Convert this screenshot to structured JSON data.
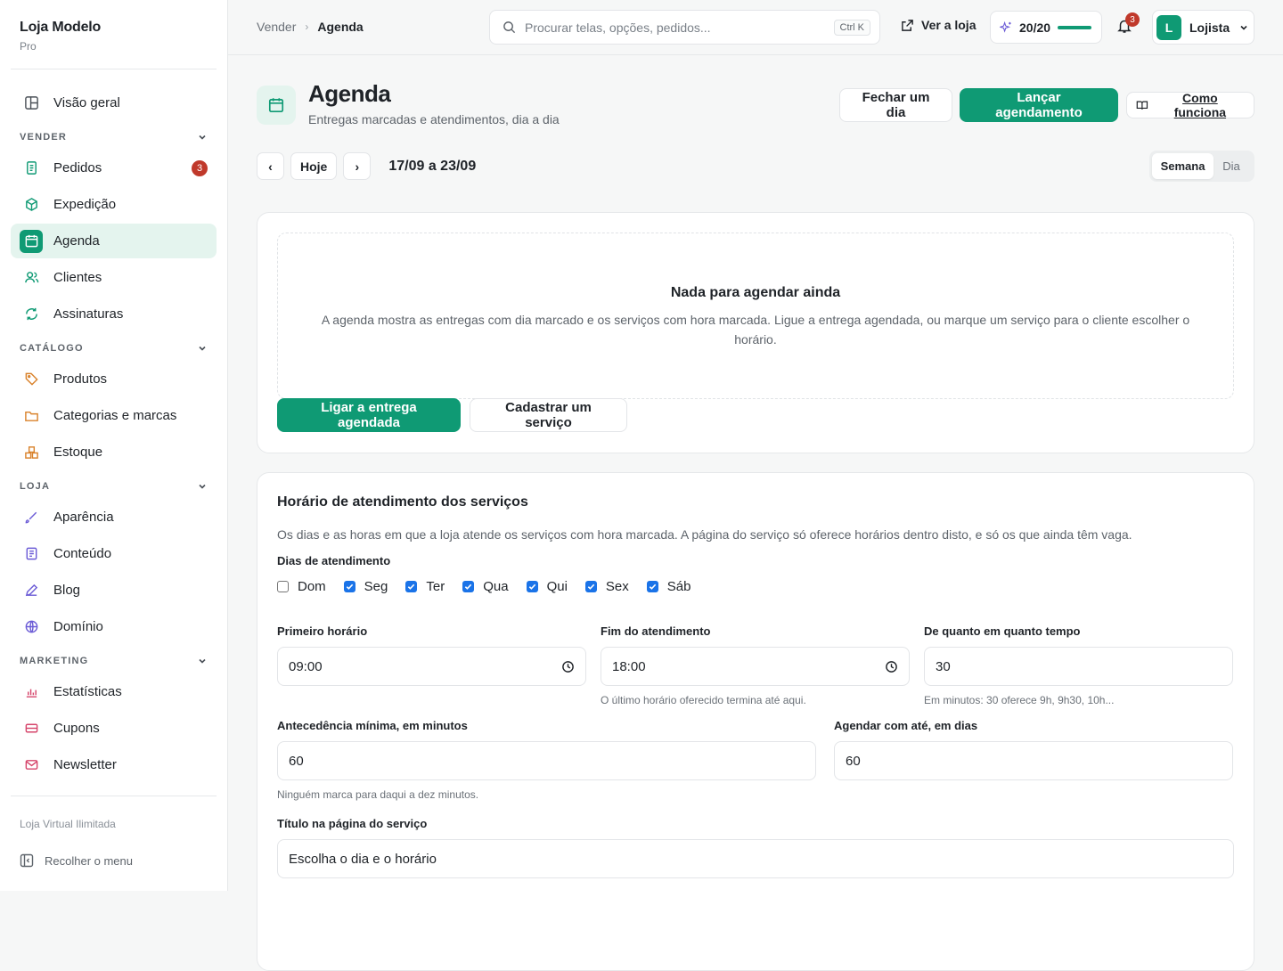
{
  "brand": {
    "name": "Loja Modelo",
    "plan": "Pro"
  },
  "sidebar": {
    "overview": "Visão geral",
    "sections": {
      "vender": "VENDER",
      "catalogo": "CATÁLOGO",
      "loja": "LOJA",
      "marketing": "MARKETING"
    },
    "items": {
      "pedidos": "Pedidos",
      "pedidos_count": "3",
      "expedicao": "Expedição",
      "agenda": "Agenda",
      "clientes": "Clientes",
      "assinaturas": "Assinaturas",
      "produtos": "Produtos",
      "categorias": "Categorias e marcas",
      "estoque": "Estoque",
      "aparencia": "Aparência",
      "conteudo": "Conteúdo",
      "blog": "Blog",
      "dominio": "Domínio",
      "estatisticas": "Estatísticas",
      "cupons": "Cupons",
      "newsletter": "Newsletter"
    },
    "license": "Loja Virtual Ilimitada",
    "collapse": "Recolher o menu"
  },
  "topbar": {
    "breadcrumb_parent": "Vender",
    "breadcrumb_current": "Agenda",
    "search_placeholder": "Procurar telas, opções, pedidos...",
    "search_shortcut": "Ctrl K",
    "view_store": "Ver a loja",
    "quota": "20/20",
    "quota_fraction": 1.0,
    "notifications": "3",
    "user_initial": "L",
    "user_name": "Lojista"
  },
  "page": {
    "title": "Agenda",
    "subtitle": "Entregas marcadas e atendimentos, dia a dia",
    "close_day": "Fechar um dia",
    "launch": "Lançar agendamento",
    "how": "Como funciona"
  },
  "calendar": {
    "prev": "‹",
    "today": "Hoje",
    "next": "›",
    "range": "17/09 a 23/09",
    "view_week": "Semana",
    "view_day": "Dia"
  },
  "empty": {
    "title": "Nada para agendar ainda",
    "text": "A agenda mostra as entregas com dia marcado e os serviços com hora marcada. Ligue a entrega agendada, ou marque um serviço para o cliente escolher o horário.",
    "action_primary": "Ligar a entrega agendada",
    "action_secondary": "Cadastrar um serviço"
  },
  "hours": {
    "title": "Horário de atendimento dos serviços",
    "description": "Os dias e as horas em que a loja atende os serviços com hora marcada. A página do serviço só oferece horários dentro disto, e só os que ainda têm vaga.",
    "days_label": "Dias de atendimento",
    "days": [
      {
        "label": "Dom",
        "checked": false
      },
      {
        "label": "Seg",
        "checked": true
      },
      {
        "label": "Ter",
        "checked": true
      },
      {
        "label": "Qua",
        "checked": true
      },
      {
        "label": "Qui",
        "checked": true
      },
      {
        "label": "Sex",
        "checked": true
      },
      {
        "label": "Sáb",
        "checked": true
      }
    ],
    "first_label": "Primeiro horário",
    "first_value": "09:00",
    "end_label": "Fim do atendimento",
    "end_value": "18:00",
    "end_hint": "O último horário oferecido termina até aqui.",
    "interval_label": "De quanto em quanto tempo",
    "interval_value": "30",
    "interval_hint": "Em minutos: 30 oferece 9h, 9h30, 10h...",
    "lead_label": "Antecedência mínima, em minutos",
    "lead_value": "60",
    "lead_hint": "Ninguém marca para daqui a dez minutos.",
    "ahead_label": "Agendar com até, em dias",
    "ahead_value": "60",
    "page_title_label": "Título na página do serviço",
    "page_title_value": "Escolha o dia e o horário"
  },
  "colors": {
    "accent": "#0f9a74",
    "accent_soft": "#e4f4ee",
    "badge": "#c0392b",
    "checkbox": "#1a73e8"
  }
}
